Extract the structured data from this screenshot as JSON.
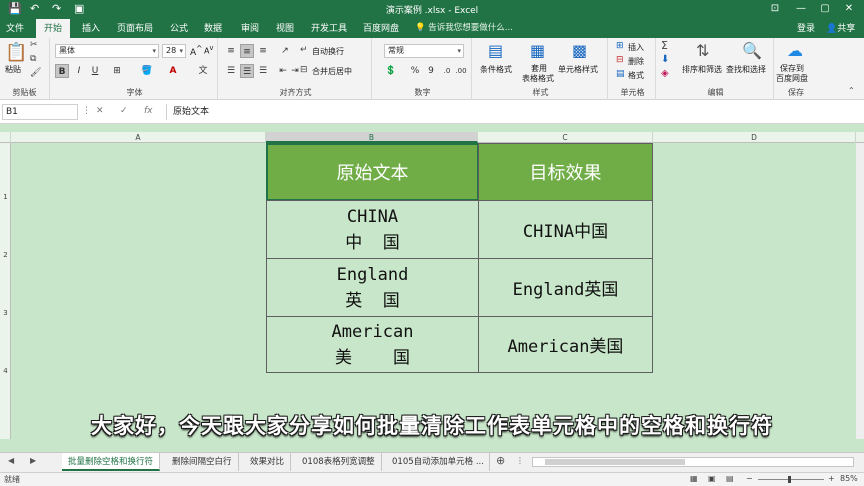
{
  "titlebar": {
    "title": "演示案例 .xlsx - Excel",
    "qa_save": "💾",
    "qa_undo": "↶",
    "qa_redo": "↷",
    "qa_extra": "▣",
    "min": "—",
    "restore": "▢",
    "close": "✕",
    "ribbon_opts": "⊡"
  },
  "tabs": {
    "items": [
      "文件",
      "开始",
      "插入",
      "页面布局",
      "公式",
      "数据",
      "审阅",
      "视图",
      "开发工具",
      "百度网盘"
    ],
    "active": "开始",
    "tellme": "告诉我您想要做什么...",
    "login": "登录",
    "share": "共享"
  },
  "ribbon": {
    "clipboard": {
      "paste": "粘贴",
      "label": "剪贴板"
    },
    "font": {
      "name": "黑体",
      "size": "28",
      "bold": "B",
      "italic": "I",
      "underline": "U",
      "label": "字体"
    },
    "alignment": {
      "wrap": "自动换行",
      "merge": "合并后居中",
      "label": "对齐方式"
    },
    "number": {
      "format": "常规",
      "percent": "%",
      "comma": "9",
      "label": "数字"
    },
    "styles": {
      "conditional": "条件格式",
      "table_fmt_1": "套用",
      "table_fmt_2": "表格格式",
      "cell_styles": "单元格样式",
      "label": "样式"
    },
    "cells": {
      "insert": "插入",
      "delete": "删除",
      "format": "格式",
      "label": "单元格"
    },
    "editing": {
      "sort": "排序和筛选",
      "find": "查找和选择",
      "label": "编辑"
    },
    "save": {
      "line1": "保存到",
      "line2": "百度网盘",
      "label": "保存"
    }
  },
  "formula_bar": {
    "name_box": "B1",
    "cancel": "✕",
    "confirm": "✓",
    "fx": "fx",
    "content": "原始文本"
  },
  "columns": [
    "A",
    "B",
    "C",
    "D"
  ],
  "selected_column": "B",
  "rows": [
    "1",
    "2",
    "3",
    "4"
  ],
  "table": {
    "headers": [
      "原始文本",
      "目标效果"
    ],
    "rows": [
      {
        "source_line1": "CHINA",
        "source_line2": "中  国",
        "target": "CHINA中国"
      },
      {
        "source_line1": "England",
        "source_line2": "英  国",
        "target": "England英国"
      },
      {
        "source_line1": "American",
        "source_line2": "美    国",
        "target": "American美国"
      }
    ]
  },
  "subtitle": "大家好，今天跟大家分享如何批量清除工作表单元格中的空格和换行符",
  "sheet_tabs": [
    "批量删除空格和换行符",
    "删除间隔空白行",
    "效果对比",
    "0108表格列宽调整",
    "0105自动添加单元格 ..."
  ],
  "active_sheet": "批量删除空格和换行符",
  "status": {
    "ready": "就绪",
    "zoom": "85%"
  }
}
